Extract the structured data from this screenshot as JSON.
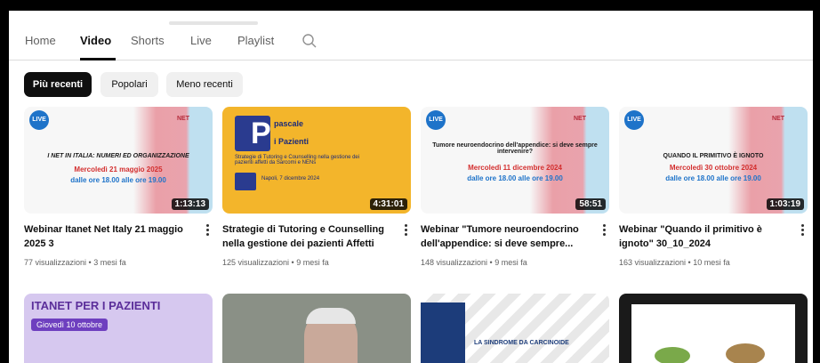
{
  "tabs": [
    {
      "label": "Home",
      "active": false
    },
    {
      "label": "Video",
      "active": true
    },
    {
      "label": "Shorts",
      "active": false
    },
    {
      "label": "Live",
      "active": false
    },
    {
      "label": "Playlist",
      "active": false
    }
  ],
  "search_icon": "search-icon",
  "chips": [
    {
      "label": "Più recenti",
      "active": true
    },
    {
      "label": "Popolari",
      "active": false
    },
    {
      "label": "Meno recenti",
      "active": false
    }
  ],
  "videos": [
    {
      "title": "Webinar Itanet Net Italy 21 maggio 2025 3",
      "meta": "77 visualizzazioni • 3 mesi fa",
      "duration": "1:13:13",
      "thumb_line1": "I NET IN ITALIA: NUMERI ED ORGANIZZAZIONE",
      "thumb_line2": "Mercoledì 21 maggio 2025",
      "thumb_line3": "dalle ore 18.00 alle ore 19.00"
    },
    {
      "title": "Strategie di Tutoring e Counselling nella gestione dei pazienti Affetti d...",
      "meta": "125 visualizzazioni • 9 mesi fa",
      "duration": "4:31:01",
      "thumb_line1": "pascale",
      "thumb_line2": "i Pazienti",
      "thumb_line3": "Strategie di Tutoring e Counselling nella gestione dei pazienti affetti da Sarcomi e NENs",
      "thumb_line4": "Napoli, 7 dicembre 2024"
    },
    {
      "title": "Webinar \"Tumore neuroendocrino dell'appendice: si deve sempre...",
      "meta": "148 visualizzazioni • 9 mesi fa",
      "duration": "58:51",
      "thumb_line1": "Tumore neuroendocrino dell'appendice: si deve sempre intervenire?",
      "thumb_line2": "Mercoledì 11 dicembre 2024",
      "thumb_line3": "dalle ore 18.00 alle ore 19.00"
    },
    {
      "title": "Webinar \"Quando il primitivo è ignoto\" 30_10_2024",
      "meta": "163 visualizzazioni • 10 mesi fa",
      "duration": "1:03:19",
      "thumb_line1": "QUANDO IL PRIMITIVO È IGNOTO",
      "thumb_line2": "Mercoledì 30 ottobre 2024",
      "thumb_line3": "dalle ore 18.00 alle ore 19.00"
    }
  ],
  "row2": {
    "card1_line1": "ITANET PER I PAZIENTI",
    "card1_line2": "Giovedì 10 ottobre",
    "card3_line1": "LA SINDROME DA CARCINOIDE"
  },
  "badges": {
    "live": "LIVE",
    "net": "NET"
  },
  "colors": {
    "accent_dark": "#0f0f0f",
    "chip_bg": "#f0f0f0",
    "meta_gray": "#606060"
  }
}
